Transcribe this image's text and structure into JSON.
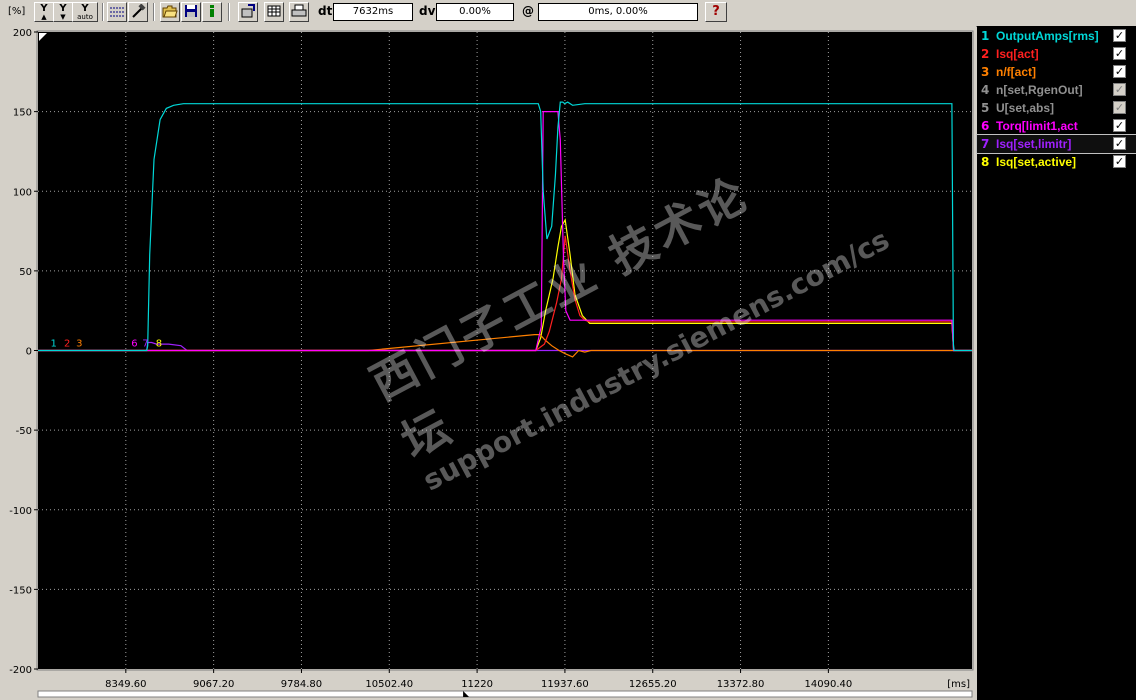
{
  "toolbar": {
    "unit": "[%]",
    "y_up_label": "Y",
    "y_down_label": "Y",
    "y_auto_label": "Y",
    "y_auto_sub": "auto",
    "help_label": "?",
    "dt_label": "dt",
    "dt_value": "7632ms",
    "dv_label": "dv",
    "dv_value": "0.00%",
    "at_label": "@",
    "at_value": "0ms, 0.00%"
  },
  "legend": [
    {
      "num": "1",
      "name": "OutputAmps[rms]",
      "color": "#00d8d8",
      "checked": true
    },
    {
      "num": "2",
      "name": "Isq[act]",
      "color": "#ff2020",
      "checked": true
    },
    {
      "num": "3",
      "name": "n/f[act]",
      "color": "#ff8000",
      "checked": true
    },
    {
      "num": "4",
      "name": "n[set,RgenOut]",
      "color": "#909090",
      "checked": false
    },
    {
      "num": "5",
      "name": "U[set,abs]",
      "color": "#909090",
      "checked": false
    },
    {
      "num": "6",
      "name": "Torq[limit1,act",
      "color": "#ff00ff",
      "checked": true
    },
    {
      "num": "7",
      "name": "Isq[set,limitr]",
      "color": "#a020ff",
      "checked": true
    },
    {
      "num": "8",
      "name": "Isq[set,active]",
      "color": "#ffff00",
      "checked": true
    }
  ],
  "watermark": {
    "cn": "西门子工业 技术论坛",
    "url": "support.industry.siemens.com/cs"
  },
  "chart_data": {
    "type": "line",
    "ylim": [
      -200,
      200
    ],
    "xlim": [
      7632,
      15264
    ],
    "yticks": [
      -200,
      -150,
      -100,
      -50,
      0,
      50,
      100,
      150,
      200
    ],
    "ytick_labels": [
      "-200",
      "-150",
      "-100",
      "-50",
      "0",
      "50",
      "100",
      "150",
      "200"
    ],
    "xticks": [
      8349.6,
      9067.2,
      9784.8,
      10502.4,
      11220,
      11937.6,
      12655.2,
      13372.8,
      14090.4
    ],
    "xtick_labels": [
      "8349.60",
      "9067.20",
      "9784.80",
      "10502.40",
      "11220",
      "11937.60",
      "12655.20",
      "13372.80",
      "14090.40"
    ],
    "xunit": "[ms]",
    "grid": true,
    "trace_markers": [
      {
        "text": "1",
        "color": "#00d8d8",
        "x": 7760
      },
      {
        "text": "2",
        "color": "#ff2020",
        "x": 7870
      },
      {
        "text": "3",
        "color": "#ff8000",
        "x": 7970
      },
      {
        "text": "6",
        "color": "#ff00ff",
        "x": 8420
      },
      {
        "text": "7",
        "color": "#a020ff",
        "x": 8510
      },
      {
        "text": "8",
        "color": "#ffff00",
        "x": 8620
      }
    ],
    "series": [
      {
        "name": "OutputAmps[rms]",
        "color": "#00d8d8",
        "x": [
          7632,
          8520,
          8528,
          8545,
          8580,
          8630,
          8680,
          8740,
          8820,
          11720,
          11740,
          11760,
          11790,
          11830,
          11860,
          11880,
          11900,
          11920,
          11935,
          11960,
          12000,
          12100,
          12200,
          15100,
          15112,
          15118,
          15264
        ],
        "y": [
          0,
          0,
          3,
          60,
          120,
          145,
          152,
          154,
          155,
          155,
          150,
          100,
          70,
          78,
          110,
          140,
          156,
          156,
          155,
          156,
          154,
          155,
          155,
          155,
          4,
          0,
          0
        ]
      },
      {
        "name": "Isq[act]",
        "color": "#ff2020",
        "x": [
          7632,
          11700,
          11770,
          11810,
          11870,
          11910,
          11940,
          11980,
          12020,
          12060,
          12100,
          12140,
          12200,
          15100,
          15114,
          15264
        ],
        "y": [
          0,
          0,
          4,
          12,
          30,
          45,
          72,
          50,
          32,
          22,
          19,
          18,
          18,
          18,
          0,
          0
        ]
      },
      {
        "name": "n/f[act]",
        "color": "#ff8000",
        "x": [
          7632,
          10330,
          11690,
          11735,
          11770,
          11830,
          11890,
          11940,
          12000,
          12050,
          12100,
          12150,
          12200,
          15100,
          15114,
          15264
        ],
        "y": [
          0,
          0,
          10,
          10,
          7,
          3,
          0,
          -2,
          -4,
          0,
          -1,
          0,
          0,
          0,
          0,
          0
        ]
      },
      {
        "name": "Torq[limit1,act",
        "color": "#ff00ff",
        "x": [
          7632,
          11700,
          11745,
          11760,
          11830,
          11880,
          11900,
          11925,
          11945,
          11980,
          12040,
          12100,
          12200,
          15100,
          15114,
          15264
        ],
        "y": [
          0,
          0,
          15,
          150,
          150,
          150,
          132,
          60,
          25,
          19,
          19,
          19,
          19,
          19,
          0,
          0
        ]
      },
      {
        "name": "Isq[set,limitr]",
        "color": "#a020ff",
        "x": [
          7632,
          8520,
          8528,
          8560,
          8600,
          8700,
          8800,
          8850,
          11700,
          15264
        ],
        "y": [
          0,
          0,
          5,
          5,
          4,
          4,
          3,
          0,
          0,
          0
        ]
      },
      {
        "name": "Isq[set,active]",
        "color": "#ffff00",
        "x": [
          7632,
          11700,
          11740,
          11780,
          11840,
          11880,
          11910,
          11940,
          11980,
          12020,
          12080,
          12140,
          12200,
          15100,
          15114,
          15264
        ],
        "y": [
          0,
          0,
          8,
          25,
          45,
          65,
          78,
          82,
          60,
          35,
          22,
          17,
          17,
          17,
          0,
          0
        ]
      }
    ]
  }
}
